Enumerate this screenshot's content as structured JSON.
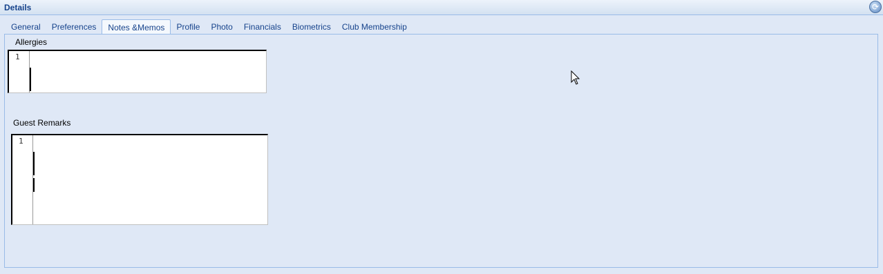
{
  "window": {
    "title": "Details"
  },
  "tabs": [
    {
      "label": "General",
      "active": false
    },
    {
      "label": "Preferences",
      "active": false
    },
    {
      "label": "Notes &Memos",
      "active": true
    },
    {
      "label": "Profile",
      "active": false
    },
    {
      "label": "Photo",
      "active": false
    },
    {
      "label": "Financials",
      "active": false
    },
    {
      "label": "Biometrics",
      "active": false
    },
    {
      "label": "Club Membership",
      "active": false
    }
  ],
  "fields": {
    "allergies": {
      "label": "Allergies",
      "line_number": "1"
    },
    "guest_remarks": {
      "label": "Guest Remarks",
      "line_number": "1"
    }
  },
  "icons": {
    "refresh": "refresh-icon",
    "cursor": "mouse-pointer-icon"
  },
  "colors": {
    "tab_text": "#15428b",
    "panel_bg": "#dfe8f6",
    "border": "#99bbe8"
  }
}
